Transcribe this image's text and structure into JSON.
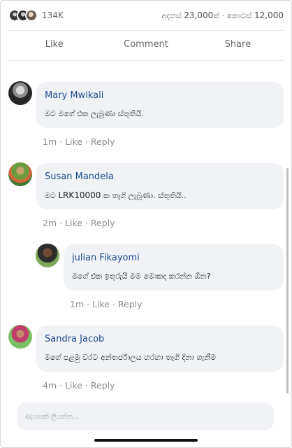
{
  "stats": {
    "reaction_count": "134K",
    "views_label": "අදහස් ",
    "views_value": "23,000",
    "views_suffix": "ක් · කොටස් ",
    "shares_value": "12,000"
  },
  "actions": {
    "like": "Like",
    "comment": "Comment",
    "share": "Share"
  },
  "comments": [
    {
      "name": "Mary Mwikali",
      "text": "මට මගේ එක ලැබුණා ස්තුතියි.",
      "time": "1m",
      "like": "Like",
      "reply": "Reply"
    },
    {
      "name": "Susan Mandela",
      "text_a": "මට ",
      "text_b": "LRK10000",
      "text_c": " ක තෑගි ලැබුණා. ස්තුතියි..",
      "time": "2m",
      "like": "Like",
      "reply": "Reply"
    },
    {
      "name": "julian Fikayomi",
      "text": "මගේ එක ඉතුරුයි මම මොකද කරන්න ඕන?",
      "time": "1m",
      "like": "Like",
      "reply": "Reply"
    },
    {
      "name": "Sandra Jacob",
      "text": "මගේ පළමු වරට අන්තර්ජාලය හරහා තෑගි දිනා ගැනීම",
      "time": "4m",
      "like": "Like",
      "reply": "Reply"
    }
  ],
  "composer": {
    "placeholder": "අදහසක් ලියන්න..."
  }
}
